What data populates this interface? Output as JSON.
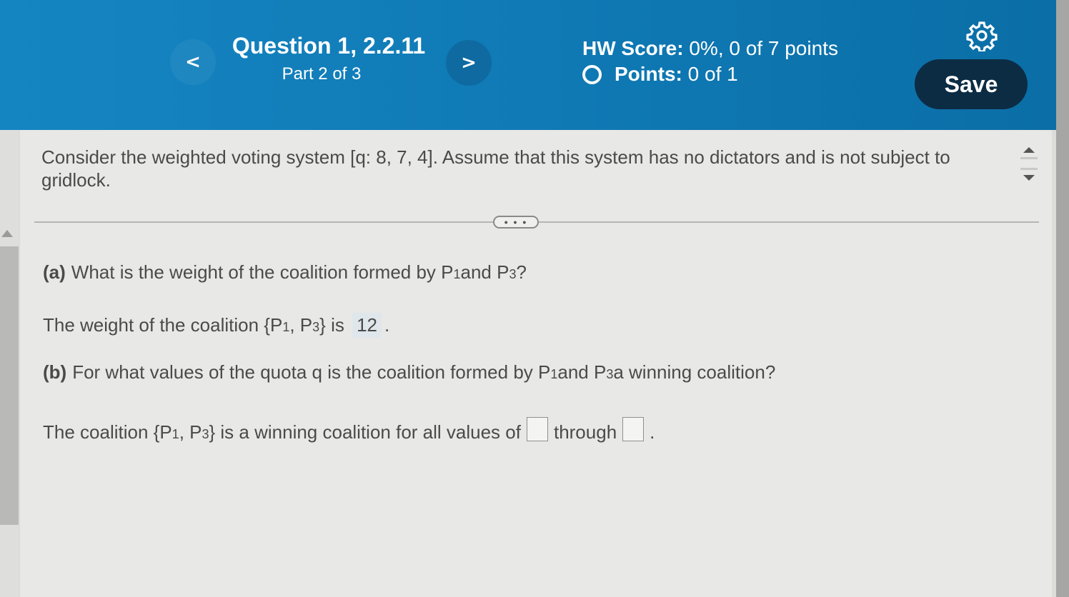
{
  "header": {
    "prev_symbol": "<",
    "next_symbol": ">",
    "question_title": "Question 1, 2.2.11",
    "part": "Part 2 of 3",
    "hw_score_label": "HW Score:",
    "hw_score_value": "0%, 0 of 7 points",
    "points_label": "Points:",
    "points_value": "0 of 1",
    "save_label": "Save"
  },
  "problem": {
    "text": "Consider the weighted voting system [q: 8, 7, 4]. Assume that this system has no dictators and is not subject to gridlock."
  },
  "expand_label": "• • •",
  "part_a": {
    "label": "(a)",
    "question_pre": "What is the weight of the coalition formed by P",
    "sub1": "1",
    "mid": " and P",
    "sub2": "3",
    "end": "?",
    "answer_pre": "The weight of the coalition {P",
    "answer_sub1": "1",
    "answer_mid": ", P",
    "answer_sub2": "3",
    "answer_post": "} is",
    "answer_value": "12",
    "answer_end": "."
  },
  "part_b": {
    "label": "(b)",
    "question_pre": "For what values of the quota q is the coalition formed by P",
    "sub1": "1",
    "mid": " and P",
    "sub2": "3",
    "end": " a winning coalition?",
    "answer_pre": "The coalition {P",
    "answer_sub1": "1",
    "answer_mid": ", P",
    "answer_sub2": "3",
    "answer_post": "} is a winning coalition for all values of",
    "input1_value": "",
    "through": "through",
    "input2_value": "",
    "answer_end": "."
  }
}
